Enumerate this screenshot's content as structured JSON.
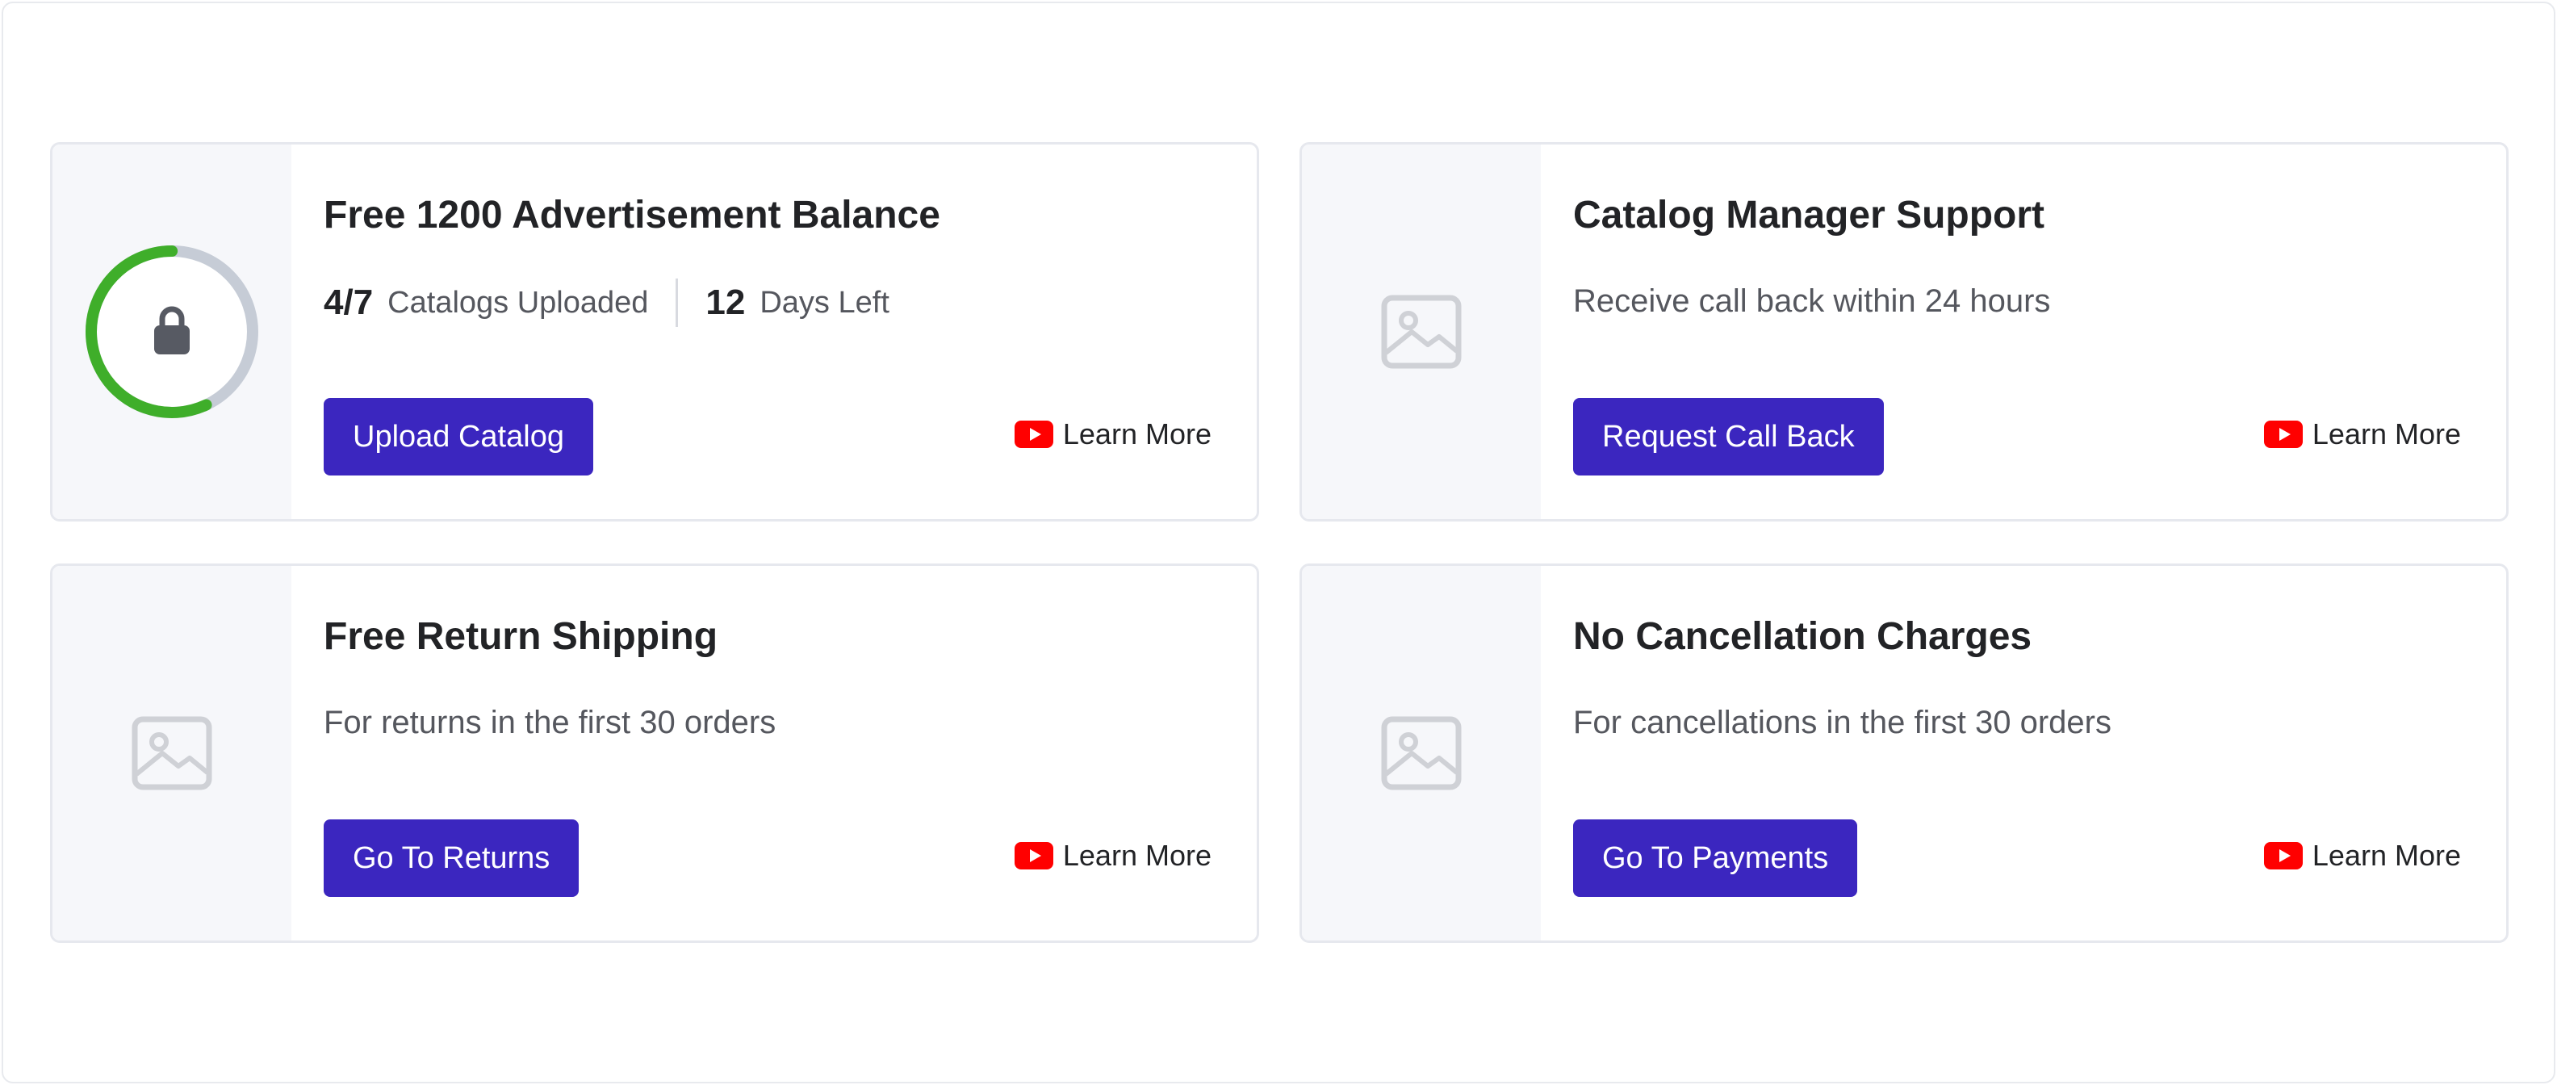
{
  "cards": [
    {
      "title": "Free 1200 Advertisement Balance",
      "stats": {
        "uploaded_value": "4/7",
        "uploaded_label": "Catalogs Uploaded",
        "days_value": "12",
        "days_label": "Days Left"
      },
      "progress_fraction": 0.57,
      "media_icon": "lock-icon",
      "cta_label": "Upload Catalog",
      "learn_more_label": "Learn More"
    },
    {
      "title": "Catalog Manager Support",
      "subtitle": "Receive call back within 24 hours",
      "media_icon": "image-placeholder-icon",
      "cta_label": "Request Call Back",
      "learn_more_label": "Learn More"
    },
    {
      "title": "Free Return Shipping",
      "subtitle": "For returns in the first 30 orders",
      "media_icon": "image-placeholder-icon",
      "cta_label": "Go To Returns",
      "learn_more_label": "Learn More"
    },
    {
      "title": "No Cancellation Charges",
      "subtitle": "For cancellations in the first 30 orders",
      "media_icon": "image-placeholder-icon",
      "cta_label": "Go To Payments",
      "learn_more_label": "Learn More"
    }
  ],
  "colors": {
    "primary_button": "#3b26bf",
    "progress_done": "#3fae2a",
    "progress_remaining": "#c6ccd6",
    "youtube_red": "#ff0000",
    "media_panel": "#f6f7fa"
  }
}
